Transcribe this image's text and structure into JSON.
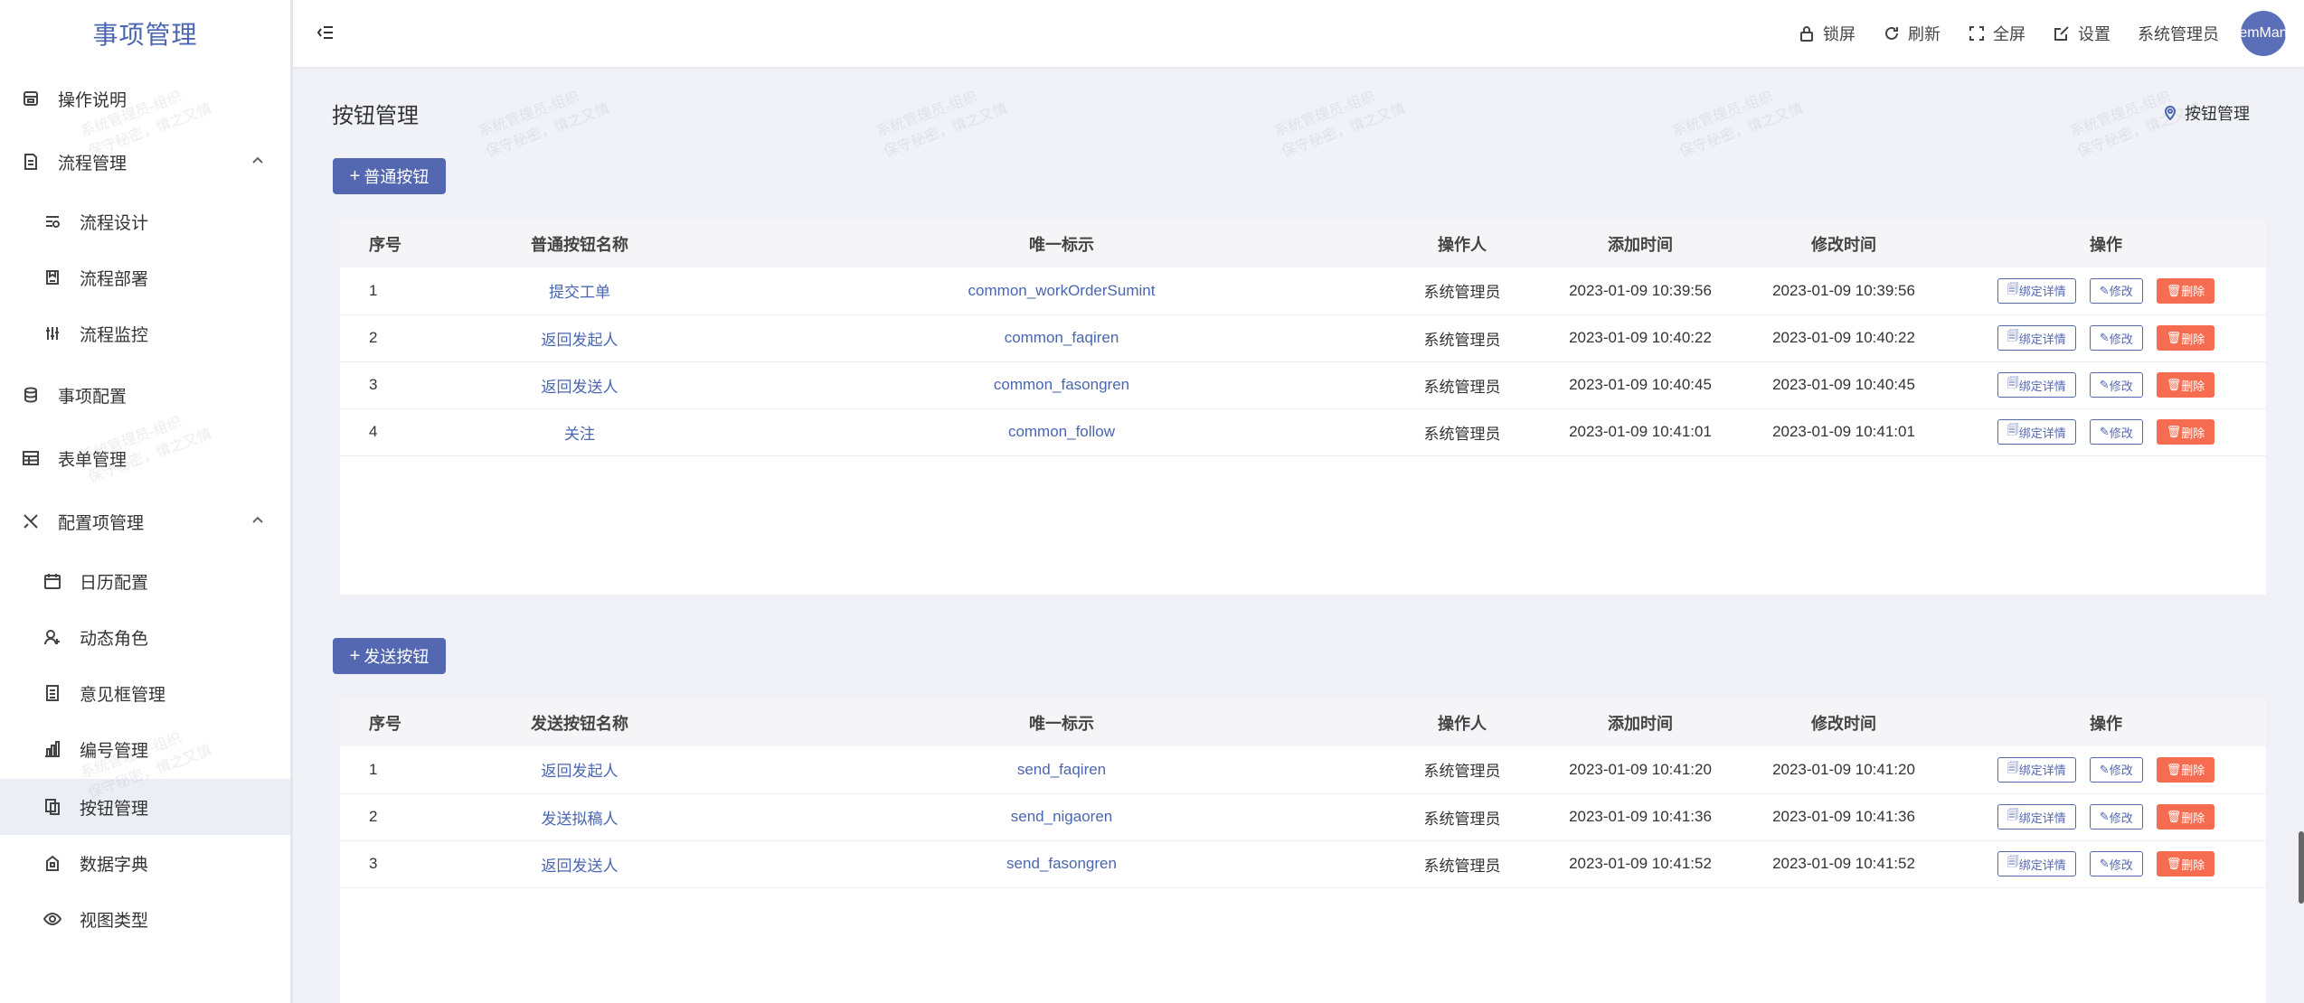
{
  "app": {
    "title": "事项管理"
  },
  "sidebar": {
    "items": [
      {
        "label": "操作说明",
        "icon": "manual-icon"
      },
      {
        "label": "流程管理",
        "icon": "flow-doc-icon"
      },
      {
        "label": "流程设计",
        "icon": "flow-design-icon"
      },
      {
        "label": "流程部署",
        "icon": "flow-deploy-icon"
      },
      {
        "label": "流程监控",
        "icon": "flow-monitor-icon"
      },
      {
        "label": "事项配置",
        "icon": "database-icon"
      },
      {
        "label": "表单管理",
        "icon": "table-icon"
      },
      {
        "label": "配置项管理",
        "icon": "tools-icon"
      },
      {
        "label": "日历配置",
        "icon": "calendar-icon"
      },
      {
        "label": "动态角色",
        "icon": "user-add-icon"
      },
      {
        "label": "意见框管理",
        "icon": "list-doc-icon"
      },
      {
        "label": "编号管理",
        "icon": "bar-chart-icon"
      },
      {
        "label": "按钮管理",
        "icon": "copy-icon"
      },
      {
        "label": "数据字典",
        "icon": "dict-icon"
      },
      {
        "label": "视图类型",
        "icon": "eye-icon"
      }
    ]
  },
  "header": {
    "lock": "锁屏",
    "refresh": "刷新",
    "fullscreen": "全屏",
    "settings": "设置",
    "user": "系统管理员",
    "avatar_text": "emMan"
  },
  "page": {
    "title": "按钮管理",
    "breadcrumb": "按钮管理"
  },
  "watermark": {
    "line1": "系统管理员-组织",
    "line2": "保守秘密，慎之又慎"
  },
  "ops": {
    "detail": "绑定详情",
    "edit": "修改",
    "delete": "删除"
  },
  "common": {
    "add_label": "普通按钮",
    "headers": {
      "idx": "序号",
      "name": "普通按钮名称",
      "key": "唯一标示",
      "operator": "操作人",
      "added": "添加时间",
      "modified": "修改时间",
      "ops": "操作"
    },
    "rows": [
      {
        "idx": "1",
        "name": "提交工单",
        "key": "common_workOrderSumint",
        "operator": "系统管理员",
        "added": "2023-01-09 10:39:56",
        "modified": "2023-01-09 10:39:56"
      },
      {
        "idx": "2",
        "name": "返回发起人",
        "key": "common_faqiren",
        "operator": "系统管理员",
        "added": "2023-01-09 10:40:22",
        "modified": "2023-01-09 10:40:22"
      },
      {
        "idx": "3",
        "name": "返回发送人",
        "key": "common_fasongren",
        "operator": "系统管理员",
        "added": "2023-01-09 10:40:45",
        "modified": "2023-01-09 10:40:45"
      },
      {
        "idx": "4",
        "name": "关注",
        "key": "common_follow",
        "operator": "系统管理员",
        "added": "2023-01-09 10:41:01",
        "modified": "2023-01-09 10:41:01"
      }
    ]
  },
  "send": {
    "add_label": "发送按钮",
    "headers": {
      "idx": "序号",
      "name": "发送按钮名称",
      "key": "唯一标示",
      "operator": "操作人",
      "added": "添加时间",
      "modified": "修改时间",
      "ops": "操作"
    },
    "rows": [
      {
        "idx": "1",
        "name": "返回发起人",
        "key": "send_faqiren",
        "operator": "系统管理员",
        "added": "2023-01-09 10:41:20",
        "modified": "2023-01-09 10:41:20"
      },
      {
        "idx": "2",
        "name": "发送拟稿人",
        "key": "send_nigaoren",
        "operator": "系统管理员",
        "added": "2023-01-09 10:41:36",
        "modified": "2023-01-09 10:41:36"
      },
      {
        "idx": "3",
        "name": "返回发送人",
        "key": "send_fasongren",
        "operator": "系统管理员",
        "added": "2023-01-09 10:41:52",
        "modified": "2023-01-09 10:41:52"
      }
    ]
  }
}
